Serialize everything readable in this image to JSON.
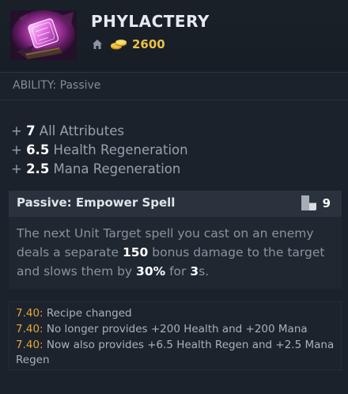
{
  "item": {
    "name": "PHYLACTERY",
    "cost": "2600",
    "icon": "phylactery-gem-icon",
    "ability_type": "ABILITY: Passive"
  },
  "attributes": [
    {
      "plus": "+ ",
      "value": "7",
      "label": " All Attributes"
    },
    {
      "plus": "+ ",
      "value": "6.5",
      "label": " Health Regeneration"
    },
    {
      "plus": "+ ",
      "value": "2.5",
      "label": " Mana Regeneration"
    }
  ],
  "ability": {
    "name": "Passive: Empower Spell",
    "cooldown": "9",
    "desc_1": "The next Unit Target spell you cast on an enemy deals a separate ",
    "desc_damage": "150",
    "desc_2": " bonus damage to the target and slows them by ",
    "desc_slow": "30%",
    "desc_3": " for ",
    "desc_duration": "3",
    "desc_4": "s."
  },
  "patch_notes": [
    {
      "version": "7.40:",
      "text": " Recipe changed"
    },
    {
      "version": "7.40:",
      "text": " No longer provides +200 Health and +200 Mana"
    },
    {
      "version": "7.40:",
      "text": " Now also provides +6.5 Health Regen and +2.5 Mana Regen"
    }
  ],
  "colors": {
    "gold": "#ebc144",
    "patch_version": "#e3a53c",
    "background": "#1b222b",
    "ability_header": "#29323d"
  }
}
